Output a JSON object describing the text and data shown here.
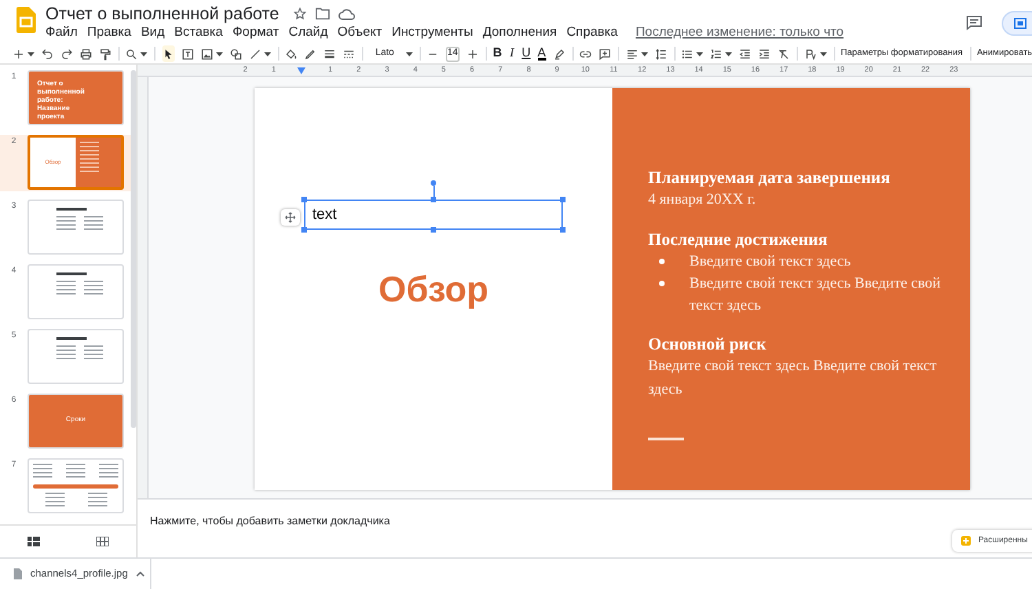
{
  "app": {
    "title": "Отчет о выполненной работе",
    "menu": [
      "Файл",
      "Правка",
      "Вид",
      "Вставка",
      "Формат",
      "Слайд",
      "Объект",
      "Инструменты",
      "Дополнения",
      "Справка"
    ],
    "last_edit": "Последнее изменение: только что"
  },
  "toolbar": {
    "font": "Lato",
    "font_size": "14",
    "format_buttons": [
      "B",
      "I",
      "U",
      "A"
    ],
    "format_options": "Параметры форматирования",
    "animate": "Анимировать"
  },
  "ruler": {
    "left_labels": [
      "2",
      "1"
    ],
    "right_labels": [
      "1",
      "2",
      "3",
      "4",
      "5",
      "6",
      "7",
      "8",
      "9",
      "10",
      "11",
      "12",
      "13",
      "14",
      "15",
      "16",
      "17",
      "18",
      "19",
      "20",
      "21",
      "22",
      "23"
    ]
  },
  "slides": [
    {
      "number": "1",
      "selected": false,
      "kind": "title",
      "text": "Отчет о выполненной работе: Название проекта"
    },
    {
      "number": "2",
      "selected": true,
      "kind": "split",
      "text": "Обзор"
    },
    {
      "number": "3",
      "selected": false,
      "kind": "columns"
    },
    {
      "number": "4",
      "selected": false,
      "kind": "columns"
    },
    {
      "number": "5",
      "selected": false,
      "kind": "columns"
    },
    {
      "number": "6",
      "selected": false,
      "kind": "section",
      "text": "Сроки"
    },
    {
      "number": "7",
      "selected": false,
      "kind": "timeline"
    }
  ],
  "slide": {
    "text_box": "text",
    "title": "Обзор",
    "sections": [
      {
        "heading": "Планируемая дата завершения",
        "body": "4 января 20XX г."
      },
      {
        "heading": "Последние достижения",
        "bullets": [
          "Введите свой текст здесь",
          "Введите свой текст здесь Введите свой текст здесь"
        ]
      },
      {
        "heading": "Основной риск",
        "body": "Введите свой текст здесь Введите свой текст здесь"
      }
    ]
  },
  "notes": {
    "placeholder": "Нажмите, чтобы добавить заметки докладчика"
  },
  "explore_button": "Расширенны",
  "download": {
    "file": "channels4_profile.jpg"
  }
}
